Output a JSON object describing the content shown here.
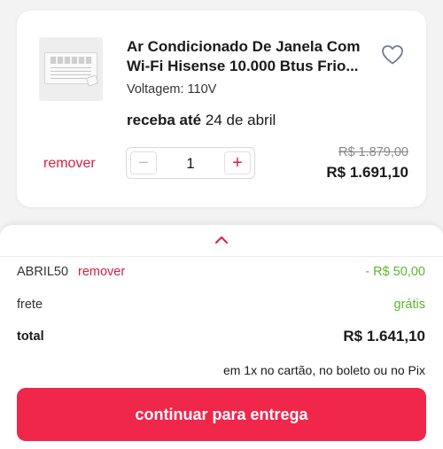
{
  "product": {
    "title_line1": "Ar Condicionado De Janela Com",
    "title_line2": "Wi-Fi Hisense 10.000 Btus Frio...",
    "voltage": "Voltagem: 110V",
    "delivery_prefix": "receba até",
    "delivery_date": "24 de abril",
    "remove_label": "remover",
    "quantity": "1",
    "minus_symbol": "−",
    "plus_symbol": "+",
    "old_price": "R$ 1.879,00",
    "price": "R$ 1.691,10",
    "thumbnail_icon": "window-air-conditioner-image",
    "favorite_icon": "heart-outline-icon"
  },
  "summary": {
    "expand_icon": "chevron-up-icon",
    "coupon_code": "ABRIL50",
    "coupon_remove_label": "remover",
    "coupon_discount": "- R$ 50,00",
    "shipping_label": "frete",
    "shipping_value": "grátis",
    "total_label": "total",
    "total_value": "R$ 1.641,10",
    "payment_note": "em 1x no cartão, no boleto ou no Pix",
    "cta_label": "continuar para entrega"
  },
  "colors": {
    "accent": "#f0264b",
    "link_red": "#d81f3e",
    "discount_green": "#5cb82e",
    "background": "#f3f3f3"
  }
}
